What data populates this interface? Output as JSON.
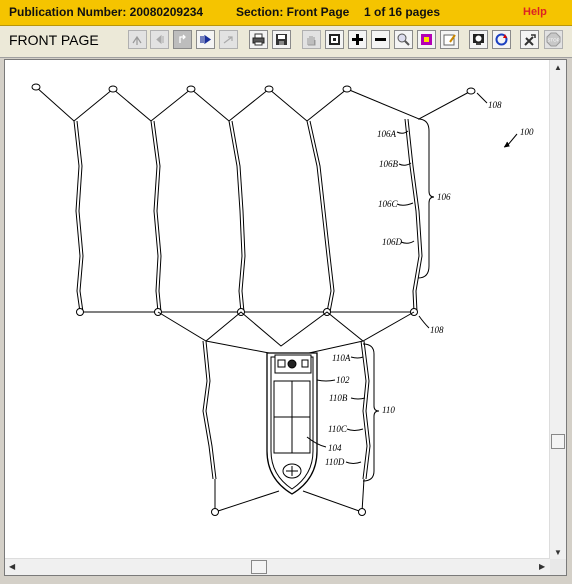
{
  "header": {
    "publication_number": "Publication Number: 20080209234",
    "section": "Section: Front Page",
    "page_info": "1 of 16 pages",
    "help_label": "Help"
  },
  "toolbar": {
    "title": "FRONT PAGE",
    "buttons": [
      "first-page",
      "previous-page",
      "go-to-page",
      "next-page",
      "last-page",
      "print",
      "save",
      "pan",
      "select-region",
      "zoom-in",
      "zoom-out",
      "zoom-magnifier",
      "view-document",
      "annotate",
      "fit-window",
      "rotate",
      "settings",
      "stop"
    ]
  },
  "drawing": {
    "labels": {
      "l100": "100",
      "l106": "106",
      "l106A": "106A",
      "l106B": "106B",
      "l106C": "106C",
      "l106D": "106D",
      "l108a": "108",
      "l108b": "108",
      "l110": "110",
      "l110A": "110A",
      "l110B": "110B",
      "l110C": "110C",
      "l110D": "110D",
      "l102": "102",
      "l104": "104"
    }
  }
}
